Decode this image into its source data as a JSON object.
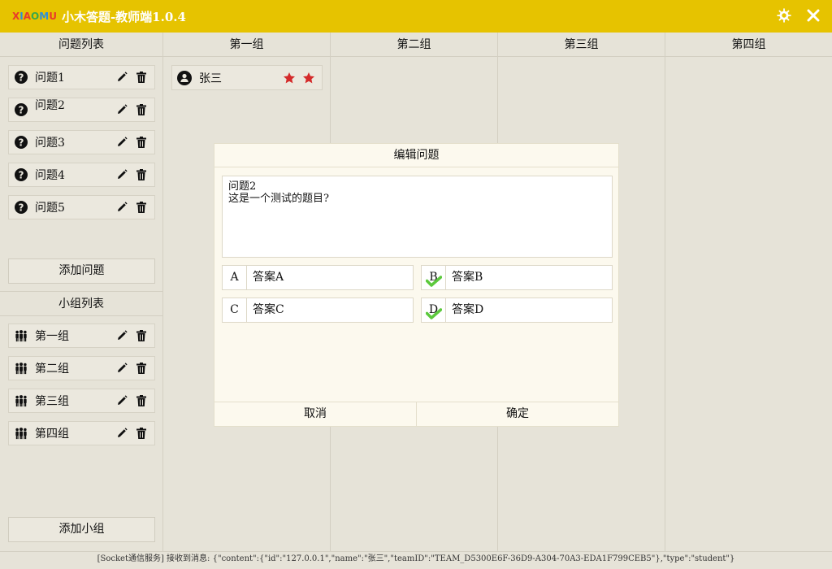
{
  "app": {
    "logo_letters": [
      "X",
      "I",
      "A",
      "O",
      "M",
      "U"
    ],
    "logo_colors": [
      "#e83b2a",
      "#2e8fd8",
      "#e83b2a",
      "#3aa848",
      "#2e8fd8",
      "#e83b2a"
    ],
    "title": "小木答题-教师端1.0.4"
  },
  "left": {
    "questions_header": "问题列表",
    "questions": [
      {
        "label": "问题1"
      },
      {
        "label": "问题2"
      },
      {
        "label": "问题3"
      },
      {
        "label": "问题4"
      },
      {
        "label": "问题5"
      }
    ],
    "add_question": "添加问题",
    "groups_header": "小组列表",
    "groups": [
      {
        "label": "第一组"
      },
      {
        "label": "第二组"
      },
      {
        "label": "第三组"
      },
      {
        "label": "第四组"
      }
    ],
    "add_group": "添加小组"
  },
  "columns": [
    {
      "title": "第一组"
    },
    {
      "title": "第二组"
    },
    {
      "title": "第三组"
    },
    {
      "title": "第四组"
    }
  ],
  "student": {
    "name": "张三",
    "stars": 2,
    "star_color": "#d42a2a"
  },
  "dialog": {
    "title": "编辑问题",
    "question_text": "问题2\n这是一个测试的题目?",
    "options": [
      {
        "key": "A",
        "value": "答案A",
        "correct": false
      },
      {
        "key": "B",
        "value": "答案B",
        "correct": true
      },
      {
        "key": "C",
        "value": "答案C",
        "correct": false
      },
      {
        "key": "D",
        "value": "答案D",
        "correct": true
      }
    ],
    "cancel": "取消",
    "confirm": "确定"
  },
  "status": "[Socket通信服务] 接收到消息: {\"content\":{\"id\":\"127.0.0.1\",\"name\":\"张三\",\"teamID\":\"TEAM_D5300E6F-36D9-A304-70A3-EDA1F799CEB5\"},\"type\":\"student\"}",
  "colors": {
    "titlebar": "#e6c300",
    "background": "#e6e3d8",
    "dialog": "#fcf9ee",
    "check": "#5cc93c"
  }
}
